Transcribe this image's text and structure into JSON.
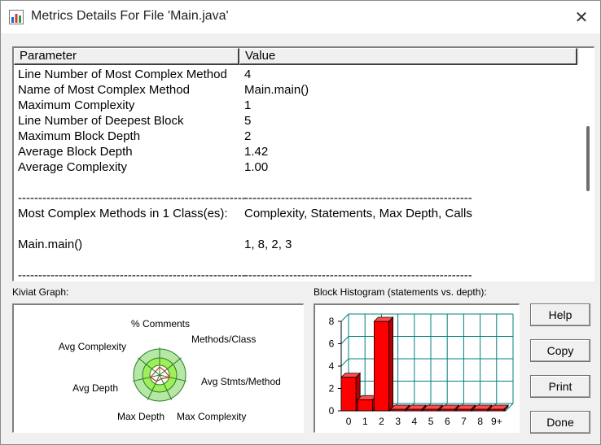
{
  "window": {
    "title": "Metrics Details For File 'Main.java'",
    "close_glyph": "✕"
  },
  "metrics": {
    "headers": {
      "parameter": "Parameter",
      "value": "Value"
    },
    "rows": [
      {
        "parameter": "Line Number of Most Complex Method",
        "value": "4"
      },
      {
        "parameter": "Name of Most Complex Method",
        "value": "Main.main()"
      },
      {
        "parameter": "Maximum Complexity",
        "value": "1"
      },
      {
        "parameter": "Line Number of Deepest Block",
        "value": "5"
      },
      {
        "parameter": "Maximum Block Depth",
        "value": "2"
      },
      {
        "parameter": "Average Block Depth",
        "value": "1.42"
      },
      {
        "parameter": "Average Complexity",
        "value": "1.00"
      },
      {
        "parameter": "",
        "value": ""
      },
      {
        "parameter": "--------------------------------------------------------",
        "value": "--------------------------------------------------------"
      },
      {
        "parameter": "Most Complex Methods in 1 Class(es):",
        "value": "Complexity, Statements, Max Depth, Calls"
      },
      {
        "parameter": "",
        "value": ""
      },
      {
        "parameter": "Main.main()",
        "value": "1, 8, 2, 3"
      },
      {
        "parameter": "",
        "value": ""
      },
      {
        "parameter": "--------------------------------------------------------",
        "value": "--------------------------------------------------------"
      }
    ]
  },
  "kiviat": {
    "label": "Kiviat Graph:",
    "axes": [
      "% Comments",
      "Methods/Class",
      "Avg Stmts/Method",
      "Max Complexity",
      "Max Depth",
      "Avg Depth",
      "Avg Complexity"
    ],
    "colors": {
      "outer_ring": "#b5e8a4",
      "inner_ring": "#9fef59",
      "center": "#ffffff",
      "series": "#c0392b"
    }
  },
  "histogram": {
    "label": "Block Histogram (statements vs. depth):",
    "y_ticks": [
      "0",
      "2",
      "4",
      "6",
      "8"
    ],
    "x_ticks": [
      "0",
      "1",
      "2",
      "3",
      "4",
      "5",
      "6",
      "7",
      "8",
      "9+"
    ],
    "bar_color": "#ff0000",
    "grid_color": "#008080"
  },
  "chart_data": {
    "type": "bar",
    "title": "Block Histogram (statements vs. depth):",
    "categories": [
      "0",
      "1",
      "2",
      "3",
      "4",
      "5",
      "6",
      "7",
      "8",
      "9+"
    ],
    "values": [
      3,
      1,
      8,
      0,
      0,
      0,
      0,
      0,
      0,
      0
    ],
    "ylim": [
      0,
      8
    ],
    "grid": true
  },
  "buttons": {
    "help": "Help",
    "copy": "Copy",
    "print": "Print",
    "done": "Done"
  }
}
